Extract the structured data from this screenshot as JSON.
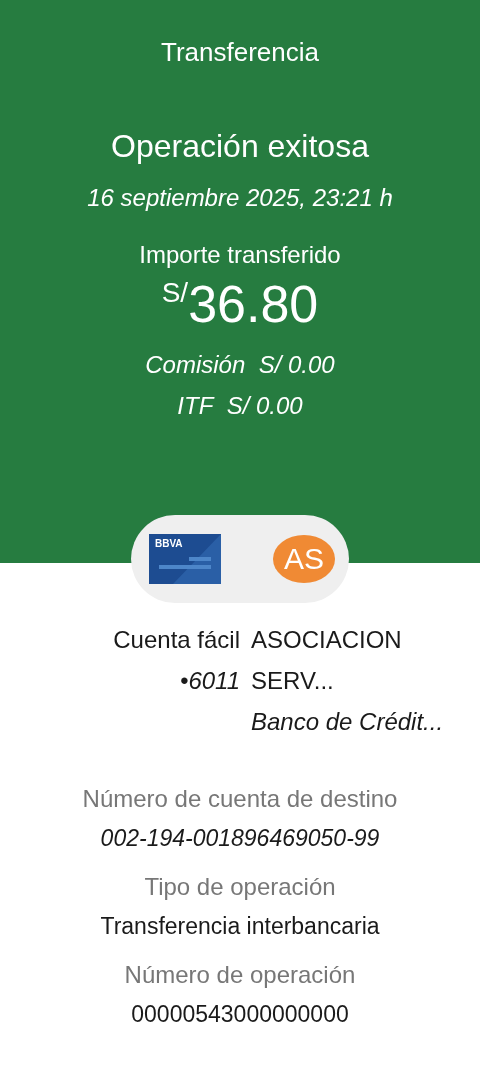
{
  "header": {
    "title": "Transferencia",
    "status": "Operación exitosa",
    "datetime": "16 septiembre 2025, 23:21 h",
    "amount_label": "Importe transferido",
    "currency": "S/",
    "amount": "36.80",
    "fees": [
      {
        "label": "Comisión",
        "value": "S/ 0.00"
      },
      {
        "label": "ITF",
        "value": "S/ 0.00"
      }
    ]
  },
  "transfer": {
    "source_card": {
      "brand": "BBVA"
    },
    "recipient_avatar": {
      "initials": "AS",
      "color": "#f08a34"
    },
    "origin": {
      "name": "Cuenta fácil",
      "number": "•6011"
    },
    "destination": {
      "name_lines": [
        "ASOCIACION",
        "SERV..."
      ],
      "bank": "Banco de Crédit..."
    }
  },
  "details": [
    {
      "label": "Número de cuenta de destino",
      "value": "002-194-001896469050-99",
      "kind": "italic"
    },
    {
      "label": "Tipo de operación",
      "value": "Transferencia interbancaria",
      "kind": "plain"
    },
    {
      "label": "Número de operación",
      "value": "00000543000000000",
      "kind": "plain"
    }
  ]
}
